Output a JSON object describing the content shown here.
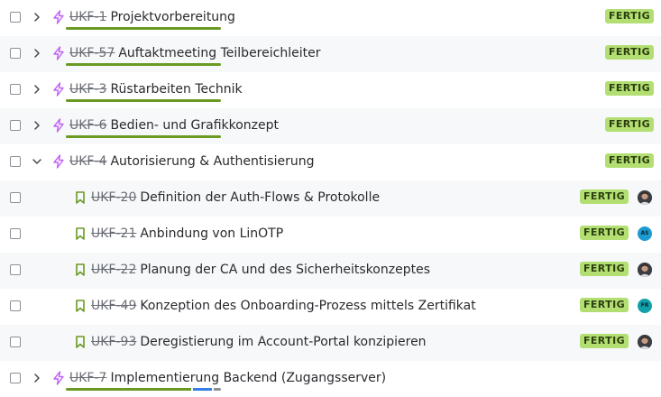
{
  "rows": [
    {
      "type": "epic",
      "expanded": false,
      "key": "UKF-1",
      "summary": "Projektvorbereitung",
      "status": "FERTIG",
      "progress_done_fraction": 1.0
    },
    {
      "type": "epic",
      "expanded": false,
      "key": "UKF-57",
      "summary": "Auftaktmeeting Teilbereichleiter",
      "status": "FERTIG",
      "progress_done_fraction": 1.0
    },
    {
      "type": "epic",
      "expanded": false,
      "key": "UKF-3",
      "summary": "Rüstarbeiten Technik",
      "status": "FERTIG",
      "progress_done_fraction": 1.0
    },
    {
      "type": "epic",
      "expanded": false,
      "key": "UKF-6",
      "summary": "Bedien- und Grafikkonzept",
      "status": "FERTIG",
      "progress_done_fraction": 1.0
    },
    {
      "type": "epic",
      "expanded": true,
      "key": "UKF-4",
      "summary": "Autorisierung & Authentisierung",
      "status": "FERTIG"
    },
    {
      "type": "story",
      "key": "UKF-20",
      "summary": "Definition der Auth-Flows & Protokolle",
      "status": "FERTIG",
      "assignee": {
        "kind": "photo"
      }
    },
    {
      "type": "story",
      "key": "UKF-21",
      "summary": "Anbindung von LinOTP",
      "status": "FERTIG",
      "assignee": {
        "kind": "initials",
        "initials": "AS",
        "color": "#1d9bd1"
      }
    },
    {
      "type": "story",
      "key": "UKF-22",
      "summary": "Planung der CA und des Sicherheitskonzeptes",
      "status": "FERTIG",
      "assignee": {
        "kind": "photo"
      }
    },
    {
      "type": "story",
      "key": "UKF-49",
      "summary": "Konzeption des Onboarding-Prozess mittels Zertifikat",
      "status": "FERTIG",
      "assignee": {
        "kind": "initials",
        "initials": "FR",
        "color": "#12a1a8"
      }
    },
    {
      "type": "story",
      "key": "UKF-93",
      "summary": "Deregistierung im Account-Portal konzipieren",
      "status": "FERTIG",
      "assignee": {
        "kind": "photo"
      }
    },
    {
      "type": "epic",
      "expanded": false,
      "key": "UKF-7",
      "summary": "Implementierung Backend (Zugangsserver)",
      "status": "",
      "progress_done_fraction": 0.81,
      "progress_in_progress_fraction": 0.13,
      "progress_todo_fraction": 0.06
    }
  ],
  "colors": {
    "done": "#6a9a23",
    "in_progress": "#357de8",
    "todo": "#8c8f97",
    "epic_icon": "#bf63f3",
    "story_icon": "#6a9a23",
    "badge_bg": "#b3df72",
    "badge_text": "#2c3e10"
  },
  "icons": {
    "epic": "lightning-icon",
    "story": "bookmark-icon",
    "expand": "chevron-right-icon",
    "collapse": "chevron-down-icon"
  }
}
